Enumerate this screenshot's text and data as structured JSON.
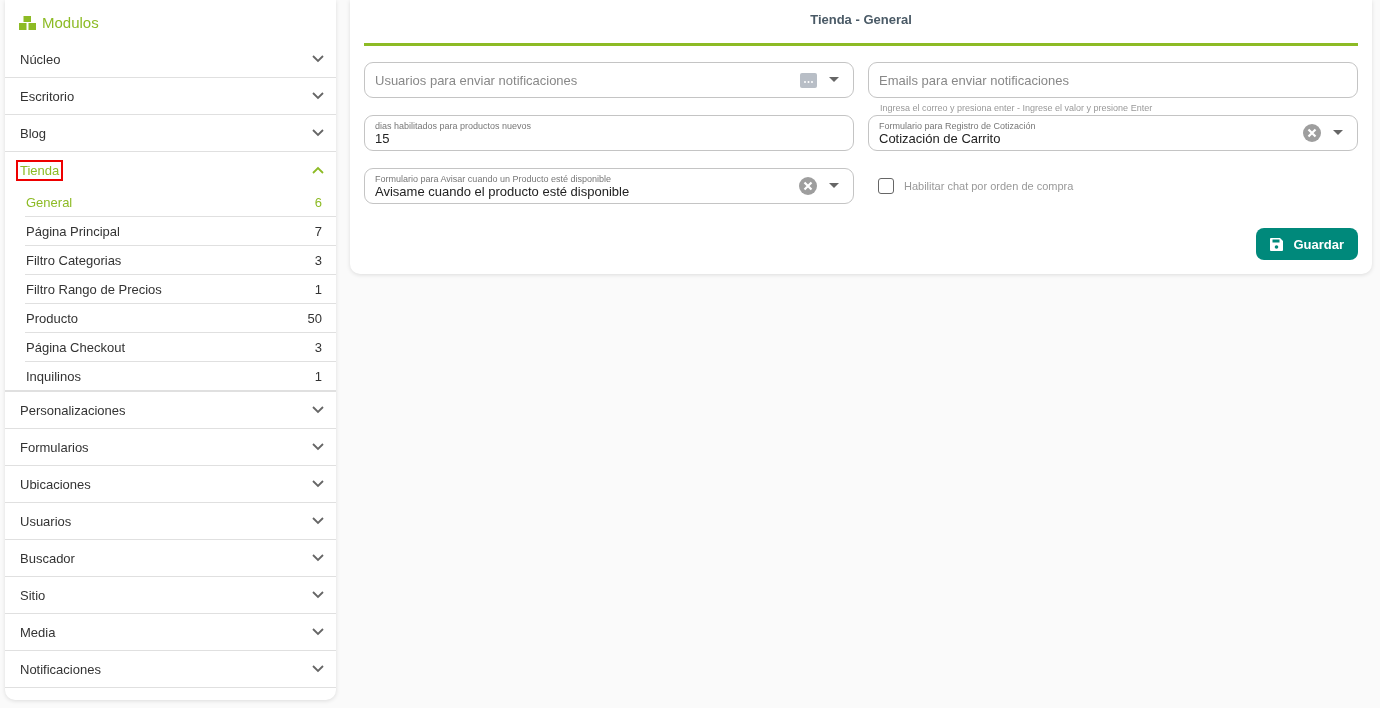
{
  "sidebar": {
    "title": "Modulos",
    "items": [
      {
        "label": "Núcleo",
        "expanded": false,
        "highlighted": false
      },
      {
        "label": "Escritorio",
        "expanded": false,
        "highlighted": false
      },
      {
        "label": "Blog",
        "expanded": false,
        "highlighted": false
      },
      {
        "label": "Tienda",
        "expanded": true,
        "highlighted": true,
        "children": [
          {
            "label": "General",
            "count": "6",
            "selected": true
          },
          {
            "label": "Página Principal",
            "count": "7",
            "selected": false
          },
          {
            "label": "Filtro Categorias",
            "count": "3",
            "selected": false
          },
          {
            "label": "Filtro Rango de Precios",
            "count": "1",
            "selected": false
          },
          {
            "label": "Producto",
            "count": "50",
            "selected": false
          },
          {
            "label": "Página Checkout",
            "count": "3",
            "selected": false
          },
          {
            "label": "Inquilinos",
            "count": "1",
            "selected": false
          }
        ]
      },
      {
        "label": "Personalizaciones",
        "expanded": false,
        "highlighted": false
      },
      {
        "label": "Formularios",
        "expanded": false,
        "highlighted": false
      },
      {
        "label": "Ubicaciones",
        "expanded": false,
        "highlighted": false
      },
      {
        "label": "Usuarios",
        "expanded": false,
        "highlighted": false
      },
      {
        "label": "Buscador",
        "expanded": false,
        "highlighted": false
      },
      {
        "label": "Sitio",
        "expanded": false,
        "highlighted": false
      },
      {
        "label": "Media",
        "expanded": false,
        "highlighted": false
      },
      {
        "label": "Notificaciones",
        "expanded": false,
        "highlighted": false
      }
    ]
  },
  "panel": {
    "title": "Tienda - General",
    "fields": [
      {
        "kind": "multiselect",
        "placeholder": "Usuarios para enviar notificaciones"
      },
      {
        "kind": "tags",
        "placeholder": "Emails para enviar notificaciones",
        "hint": "Ingresa el correo y presiona enter - Ingrese el valor y presione Enter"
      },
      {
        "kind": "text",
        "label": "dias habilitados para productos nuevos",
        "value": "15"
      },
      {
        "kind": "select",
        "label": "Formulario para Registro de Cotización",
        "value": "Cotización de Carrito"
      },
      {
        "kind": "select",
        "label": "Formulario para Avisar cuando un Producto esté disponible",
        "value": "Avisame cuando el producto esté disponible"
      },
      {
        "kind": "checkbox",
        "label": "Habilitar chat por orden de compra",
        "checked": false
      }
    ],
    "save_button": "Guardar"
  }
}
